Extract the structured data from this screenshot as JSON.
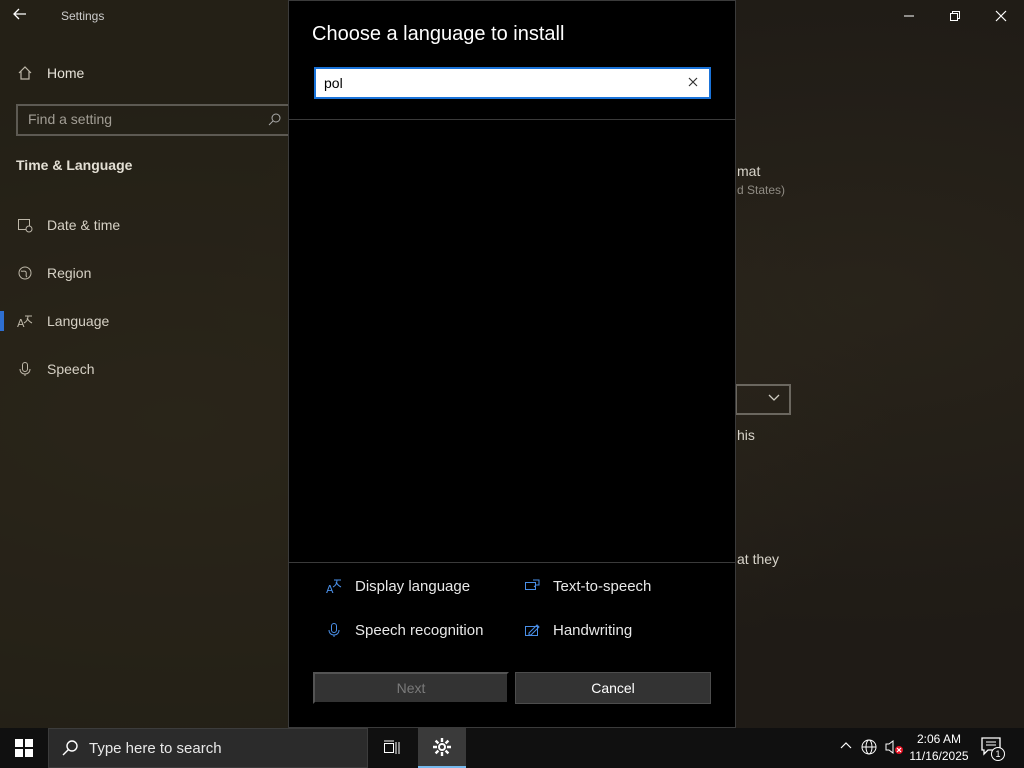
{
  "window": {
    "title": "Settings",
    "controls": [
      "minimize",
      "restore",
      "close"
    ]
  },
  "sidebar": {
    "home_label": "Home",
    "search_placeholder": "Find a setting",
    "section_title": "Time & Language",
    "items": [
      {
        "label": "Date & time",
        "icon": "calendar-clock-icon"
      },
      {
        "label": "Region",
        "icon": "globe-icon"
      },
      {
        "label": "Language",
        "icon": "language-icon",
        "selected": true
      },
      {
        "label": "Speech",
        "icon": "microphone-icon"
      }
    ]
  },
  "background_content": {
    "format_fragment": "mat",
    "region_fragment": "d States)",
    "this_fragment": "his",
    "they_fragment": "at they"
  },
  "dialog": {
    "title": "Choose a language to install",
    "search_value": "pol",
    "features": {
      "display_language": "Display language",
      "text_to_speech": "Text-to-speech",
      "speech_recognition": "Speech recognition",
      "handwriting": "Handwriting"
    },
    "next_label": "Next",
    "cancel_label": "Cancel"
  },
  "taskbar": {
    "search_placeholder": "Type here to search",
    "clock_time": "2:06 AM",
    "clock_date": "11/16/2025",
    "notification_count": "1"
  },
  "colors": {
    "accent": "#1a73d9",
    "feature_icon": "#4a8fe7",
    "dialog_bg": "#000000"
  }
}
